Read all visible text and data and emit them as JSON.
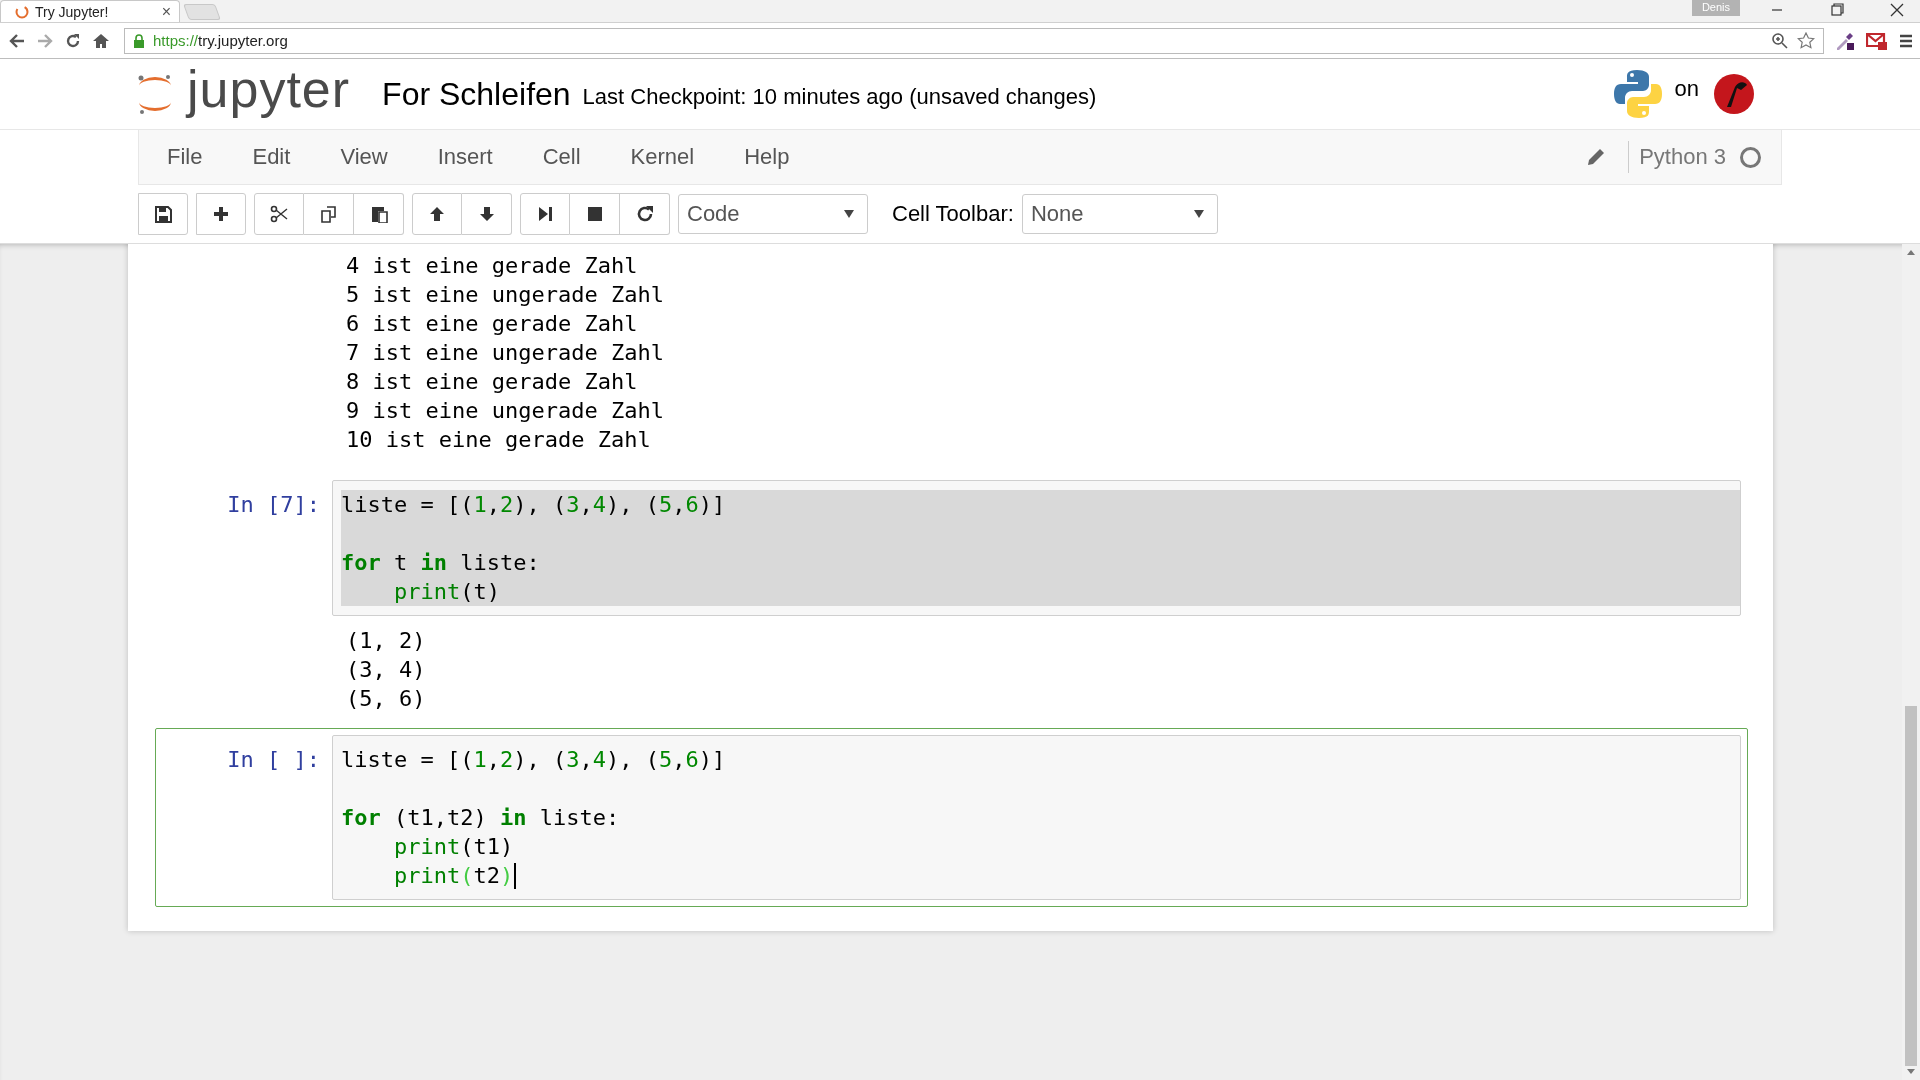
{
  "browser": {
    "tab": {
      "title": "Try Jupyter!",
      "close": "×"
    },
    "user": "Denis",
    "url_scheme": "https://",
    "url_rest": "try.jupyter.org"
  },
  "header": {
    "logo": "jupyter",
    "notebook_name": "For Schleifen",
    "checkpoint": "Last Checkpoint: 10 minutes ago (unsaved changes)",
    "hosted": "on"
  },
  "menu": [
    {
      "label": "File"
    },
    {
      "label": "Edit"
    },
    {
      "label": "View"
    },
    {
      "label": "Insert"
    },
    {
      "label": "Cell"
    },
    {
      "label": "Kernel"
    },
    {
      "label": "Help"
    }
  ],
  "kernel": {
    "name": "Python 3",
    "busy": false
  },
  "toolbar": {
    "cell_type": "Code",
    "cell_toolbar_label": "Cell Toolbar:",
    "cell_toolbar": "None"
  },
  "cells": [
    {
      "output": [
        "4 ist eine gerade Zahl",
        "5 ist eine ungerade Zahl",
        "6 ist eine gerade Zahl",
        "7 ist eine ungerade Zahl",
        "8 ist eine gerade Zahl",
        "9 ist eine ungerade Zahl",
        "10 ist eine gerade Zahl"
      ]
    },
    {
      "prompt": "In [7]:",
      "selected": false,
      "text_highlighted": true,
      "caret": false,
      "input": [
        {
          "kind": "code",
          "indented": false,
          "tokens": [
            {
              "text": "liste = [(",
              "kind": "plain"
            },
            {
              "text": "1",
              "kind": "number"
            },
            {
              "text": ",",
              "kind": "plain"
            },
            {
              "text": "2",
              "kind": "number"
            },
            {
              "text": "), (",
              "kind": "plain"
            },
            {
              "text": "3",
              "kind": "number"
            },
            {
              "text": ",",
              "kind": "plain"
            },
            {
              "text": "4",
              "kind": "number"
            },
            {
              "text": "), (",
              "kind": "plain"
            },
            {
              "text": "5",
              "kind": "number"
            },
            {
              "text": ",",
              "kind": "plain"
            },
            {
              "text": "6",
              "kind": "number"
            },
            {
              "text": ")]",
              "kind": "plain"
            }
          ]
        },
        {
          "kind": "blank"
        },
        {
          "kind": "code",
          "indented": false,
          "tokens": [
            {
              "text": "for",
              "kind": "keyword"
            },
            {
              "text": " t ",
              "kind": "plain"
            },
            {
              "text": "in",
              "kind": "keyword"
            },
            {
              "text": " liste:",
              "kind": "plain"
            }
          ]
        },
        {
          "kind": "code",
          "indented": true,
          "tokens": [
            {
              "text": "print",
              "kind": "builtin"
            },
            {
              "text": "(t)",
              "kind": "plain"
            }
          ]
        }
      ],
      "output": [
        "(1, 2)",
        "(3, 4)",
        "(5, 6)"
      ]
    },
    {
      "prompt": "In [ ]:",
      "selected": true,
      "text_highlighted": false,
      "caret": true,
      "input": [
        {
          "kind": "code",
          "indented": false,
          "tokens": [
            {
              "text": "liste = [(",
              "kind": "plain"
            },
            {
              "text": "1",
              "kind": "number"
            },
            {
              "text": ",",
              "kind": "plain"
            },
            {
              "text": "2",
              "kind": "number"
            },
            {
              "text": "), (",
              "kind": "plain"
            },
            {
              "text": "3",
              "kind": "number"
            },
            {
              "text": ",",
              "kind": "plain"
            },
            {
              "text": "4",
              "kind": "number"
            },
            {
              "text": "), (",
              "kind": "plain"
            },
            {
              "text": "5",
              "kind": "number"
            },
            {
              "text": ",",
              "kind": "plain"
            },
            {
              "text": "6",
              "kind": "number"
            },
            {
              "text": ")]",
              "kind": "plain"
            }
          ]
        },
        {
          "kind": "blank"
        },
        {
          "kind": "code",
          "indented": false,
          "tokens": [
            {
              "text": "for",
              "kind": "keyword"
            },
            {
              "text": " (t1,t2) ",
              "kind": "plain"
            },
            {
              "text": "in",
              "kind": "keyword"
            },
            {
              "text": " liste:",
              "kind": "plain"
            }
          ]
        },
        {
          "kind": "code",
          "indented": true,
          "tokens": [
            {
              "text": "print",
              "kind": "builtin"
            },
            {
              "text": "(t1)",
              "kind": "plain"
            }
          ]
        },
        {
          "kind": "code",
          "indented": true,
          "tokens": [
            {
              "text": "print",
              "kind": "builtin"
            },
            {
              "text": "(",
              "kind": "match"
            },
            {
              "text": "t2",
              "kind": "plain"
            },
            {
              "text": ")",
              "kind": "match"
            }
          ]
        }
      ]
    }
  ]
}
